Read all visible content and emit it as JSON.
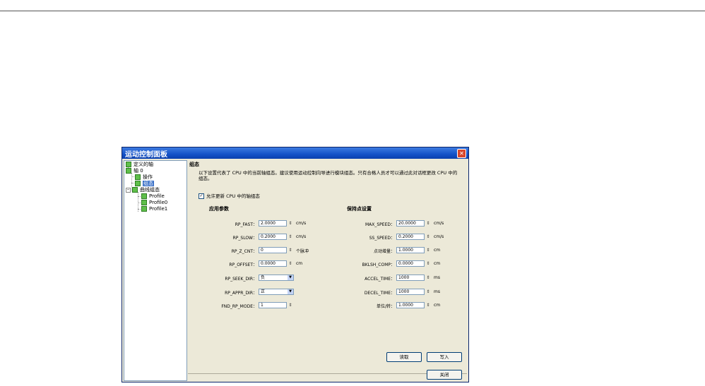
{
  "window": {
    "title": "运动控制面板"
  },
  "tree": [
    {
      "label": "定义的轴"
    },
    {
      "label": "轴 0"
    },
    {
      "label": "操作"
    },
    {
      "label": "组态",
      "selected": true
    },
    {
      "label": "曲线组态"
    },
    {
      "label": "Profile"
    },
    {
      "label": "Profile0"
    },
    {
      "label": "Profile1"
    }
  ],
  "panel": {
    "title": "组态",
    "description": "以下设置代表了 CPU 中的当前轴组态。建议使用运动控制向导进行模块组态。只有合格人员才可以通过此对话框更改 CPU 中的组态。",
    "checkbox_label": "允许更新 CPU 中的轴组态",
    "checkbox_mark": "✓",
    "left_section": "应用参数",
    "right_section": "保持点设置",
    "left_fields": [
      {
        "label": "RP_FAST：",
        "value": "2.0000",
        "unit": "cm/s",
        "kind": "spin"
      },
      {
        "label": "RP_SLOW：",
        "value": "0.2000",
        "unit": "cm/s",
        "kind": "spin"
      },
      {
        "label": "RP_Z_CNT：",
        "value": "0",
        "unit": "个脉冲",
        "kind": "spin"
      },
      {
        "label": "RP_OFFSET：",
        "value": "0.0000",
        "unit": "cm",
        "kind": "spin"
      },
      {
        "label": "RP_SEEK_DIR：",
        "value": "负",
        "unit": "",
        "kind": "select"
      },
      {
        "label": "RP_APPR_DIR：",
        "value": "正",
        "unit": "",
        "kind": "select"
      },
      {
        "label": "FND_RP_MODE：",
        "value": "1",
        "unit": "",
        "kind": "spin"
      }
    ],
    "right_fields": [
      {
        "label": "MAX_SPEED：",
        "value": "20.0000",
        "unit": "cm/s"
      },
      {
        "label": "SS_SPEED：",
        "value": "0.2000",
        "unit": "cm/s"
      },
      {
        "label": "点动增量：",
        "value": "1.0000",
        "unit": "cm"
      },
      {
        "label": "BKLSH_COMP：",
        "value": "0.0000",
        "unit": "cm"
      },
      {
        "label": "ACCEL_TIME：",
        "value": "1000",
        "unit": "ms"
      },
      {
        "label": "DECEL_TIME：",
        "value": "1000",
        "unit": "ms"
      },
      {
        "label": "单位/转：",
        "value": "1.0000",
        "unit": "cm"
      }
    ]
  },
  "buttons": {
    "read": "读取",
    "write": "写入",
    "close": "关闭"
  },
  "icons": {
    "close": "close-icon",
    "node": "tree-node-icon",
    "spinner": "spinner-icon",
    "dropdown": "chevron-down-icon"
  }
}
